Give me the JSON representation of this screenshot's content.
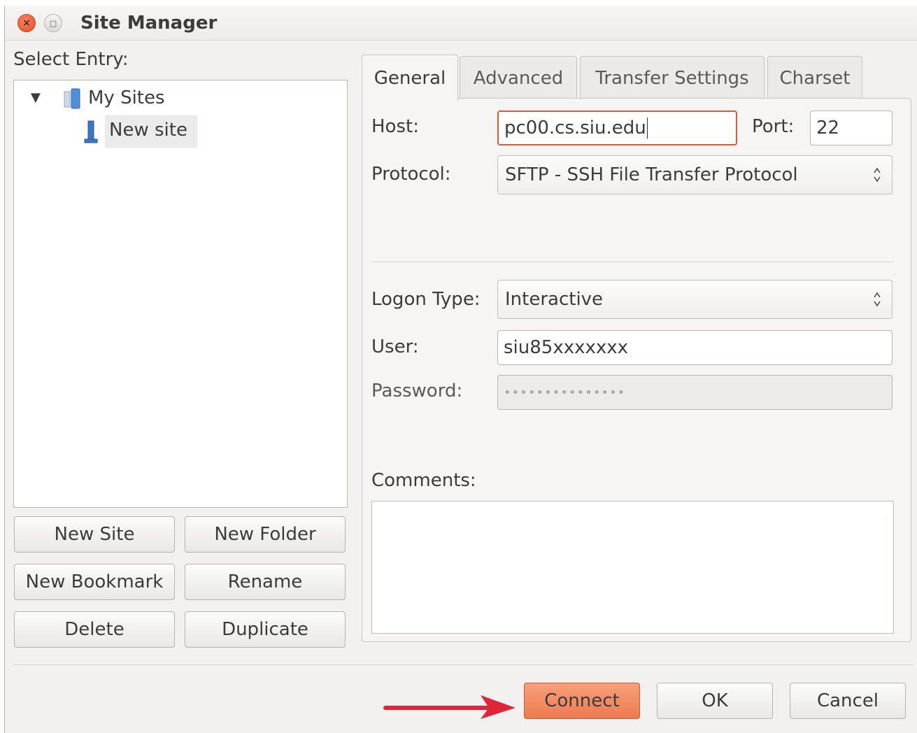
{
  "window": {
    "title": "Site Manager"
  },
  "left": {
    "select_label": "Select Entry:",
    "tree": {
      "root": "My Sites",
      "child": "New site"
    },
    "buttons": {
      "new_site": "New Site",
      "new_folder": "New Folder",
      "new_bookmark": "New Bookmark",
      "rename": "Rename",
      "delete": "Delete",
      "duplicate": "Duplicate"
    }
  },
  "tabs": [
    "General",
    "Advanced",
    "Transfer Settings",
    "Charset"
  ],
  "general": {
    "host_label": "Host:",
    "host_value": "pc00.cs.siu.edu",
    "port_label": "Port:",
    "port_value": "22",
    "protocol_label": "Protocol:",
    "protocol_value": "SFTP - SSH File Transfer Protocol",
    "logon_label": "Logon Type:",
    "logon_value": "Interactive",
    "user_label": "User:",
    "user_value": "siu85xxxxxxx",
    "password_label": "Password:",
    "password_value": "•••••••••••••••",
    "comments_label": "Comments:"
  },
  "footer": {
    "connect": "Connect",
    "ok": "OK",
    "cancel": "Cancel"
  },
  "colors": {
    "accent": "#ec7a4f",
    "focus_border": "#e05a32",
    "arrow": "#e0243a"
  }
}
